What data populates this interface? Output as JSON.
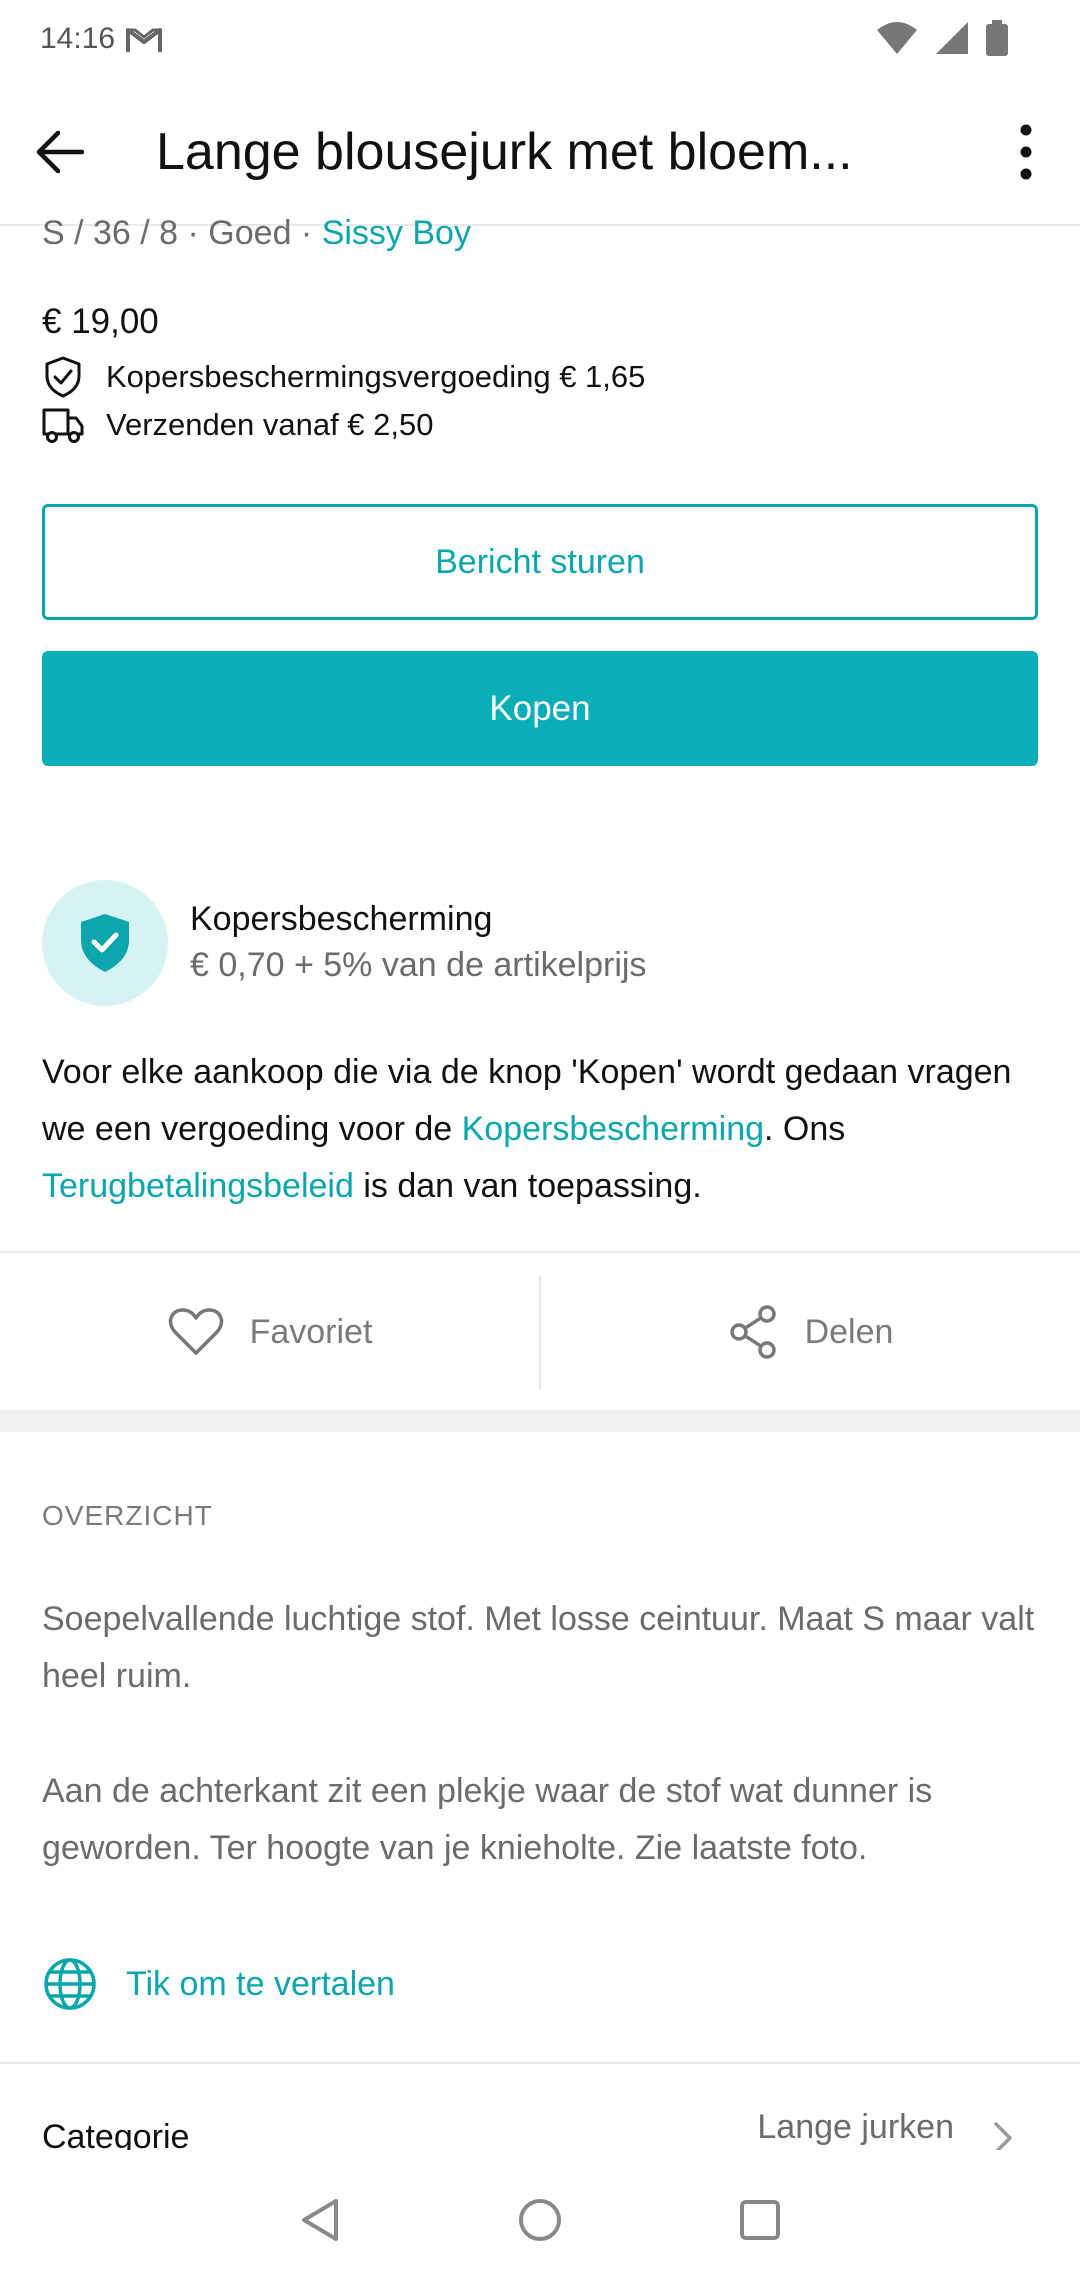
{
  "status_bar": {
    "time": "14:16"
  },
  "header": {
    "title": "Lange blousejurk met bloem..."
  },
  "item": {
    "meta": "S / 36 / 8 · Goed · ",
    "brand": "Sissy Boy",
    "price": "€ 19,00",
    "protection_fee": "Kopersbeschermingsvergoeding € 1,65",
    "shipping": "Verzenden vanaf € 2,50"
  },
  "buttons": {
    "message": "Bericht sturen",
    "buy": "Kopen"
  },
  "buyer_protection": {
    "title": "Kopersbescherming",
    "subtitle": "€ 0,70 + 5% van de artikelprijs",
    "text_1": "Voor elke aankoop die via de knop 'Kopen' wordt gedaan vragen we een vergoeding voor de ",
    "link_1": "Kopersbescherming",
    "text_2": ". Ons ",
    "link_2": "Terugbetalingsbeleid",
    "text_3": " is dan van toepassing."
  },
  "actions": {
    "favorite": "Favoriet",
    "share": "Delen"
  },
  "overview": {
    "label": "OVERZICHT",
    "paragraph_1": "Soepelvallende luchtige stof. Met losse ceintuur. Maat S maar valt heel ruim.",
    "paragraph_2": "Aan de achterkant zit een plekje waar de stof wat dunner is geworden. Ter hoogte van je knieholte. Zie laatste foto.",
    "translate": "Tik om te vertalen"
  },
  "category": {
    "label": "Categorie",
    "value": "Lange jurken"
  },
  "colors": {
    "accent": "#0aa5ad",
    "buy_button": "#0aaeb7",
    "badge_bg": "#d6f3f3"
  },
  "icons": [
    "gmail-icon",
    "wifi-icon",
    "signal-icon",
    "battery-icon",
    "back-arrow-icon",
    "more-vert-icon",
    "shield-check-icon",
    "truck-icon",
    "heart-icon",
    "share-icon",
    "globe-icon",
    "chevron-right-icon"
  ]
}
